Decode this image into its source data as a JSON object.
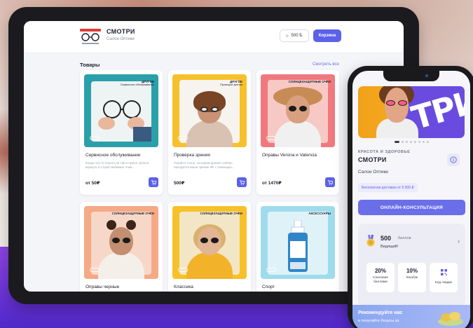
{
  "tablet": {
    "header": {
      "brand_name": "СМОТРИ",
      "brand_sub": "Салон Оптики",
      "points": "500 Б.",
      "cart_label": "Корзина"
    },
    "section_title": "Товары",
    "see_all": "Смотреть все",
    "cards": [
      {
        "name": "Сервисное обслуживание",
        "tag": "ДРУГОЕ",
        "tag_sub": "Сервисное обслуживание",
        "desc": "Когда-что-то пошло не так и нужно срочно вернуть в строй любимые очки...",
        "price": "от 50₽",
        "bg": "#2aa0aa"
      },
      {
        "name": "Проверка зрения",
        "tag": "ДРУГОЕ",
        "tag_sub": "Проверка зрения",
        "desc": "Узнайте точно, на каком уровне сейчас находится ваше зрение 👓 с помощью...",
        "price": "500₽",
        "bg": "#f6c12a"
      },
      {
        "name": "Оправы Verona и Valencia",
        "tag": "СОЛНЦЕЗАЩИТНЫЕ ОЧКИ",
        "tag_sub": "",
        "desc": "",
        "price": "от 1470₽",
        "bg": "#f0797e"
      },
      {
        "name": "Оправы черные",
        "tag": "СОЛНЦЕЗАЩИТНЫЕ ОЧКИ",
        "tag_sub": "",
        "desc": "",
        "price": "",
        "bg": "#f5a985"
      },
      {
        "name": "Классика",
        "tag": "СОЛНЦЕЗАЩИТНЫЕ ОЧКИ",
        "tag_sub": "",
        "desc": "",
        "price": "",
        "bg": "#f6c12a"
      },
      {
        "name": "Спорт",
        "tag": "АКСЕССУАРЫ",
        "tag_sub": "",
        "desc": "",
        "price": "",
        "bg": "#9edced"
      }
    ]
  },
  "phone": {
    "banner_text": "ТРИ",
    "category": "КРАСОТА И ЗДОРОВЬЕ",
    "name": "СМОТРИ",
    "subtitle": "Салон Оптики",
    "delivery": "Бесплатная доставка от 5 000 ₽",
    "consult_label": "ОНЛАЙН-КОНСУЛЬТАЦИЯ",
    "points_value": "500",
    "points_unit": "баллов",
    "level": "Видящий!",
    "stats": [
      {
        "value": "20%",
        "label": "Списание баллами"
      },
      {
        "value": "10%",
        "label": "Кешбэк"
      },
      {
        "value": "",
        "label": "Код скидки"
      }
    ],
    "recommend_title": "Рекомендуйте нас",
    "recommend_sub": "и получайте бонусы за"
  },
  "colors": {
    "accent": "#5b61e8",
    "purple_bg": "#6b33d8"
  }
}
